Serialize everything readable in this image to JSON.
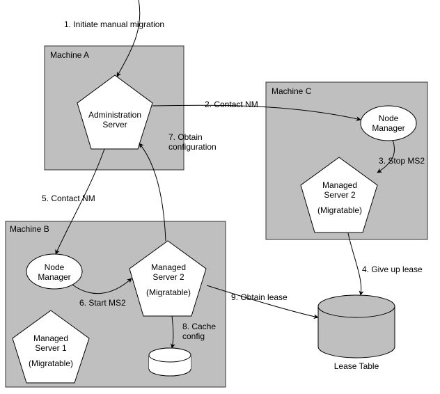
{
  "machines": {
    "a": "Machine A",
    "b": "Machine B",
    "c": "Machine C"
  },
  "nodes": {
    "admin_server": "Administration\nServer",
    "node_manager_a": "Node\nManager",
    "node_manager_c": "Node\nManager",
    "managed_server_1": "Managed\nServer 1",
    "managed_server_1_mig": "(Migratable)",
    "managed_server_2b": "Managed\nServer 2",
    "managed_server_2b_mig": "(Migratable)",
    "managed_server_2c": "Managed\nServer 2",
    "managed_server_2c_mig": "(Migratable)",
    "lease_table": "Lease Table"
  },
  "steps": {
    "s1": "1. Initiate manual migration",
    "s2": "2. Contact NM",
    "s3": "3. Stop MS2",
    "s4": "4. Give up lease",
    "s5": "5. Contact NM",
    "s6": "6. Start MS2",
    "s7": "7. Obtain\nconfiguration",
    "s8": "8. Cache\nconfig",
    "s9": "9.  Obtain lease"
  }
}
